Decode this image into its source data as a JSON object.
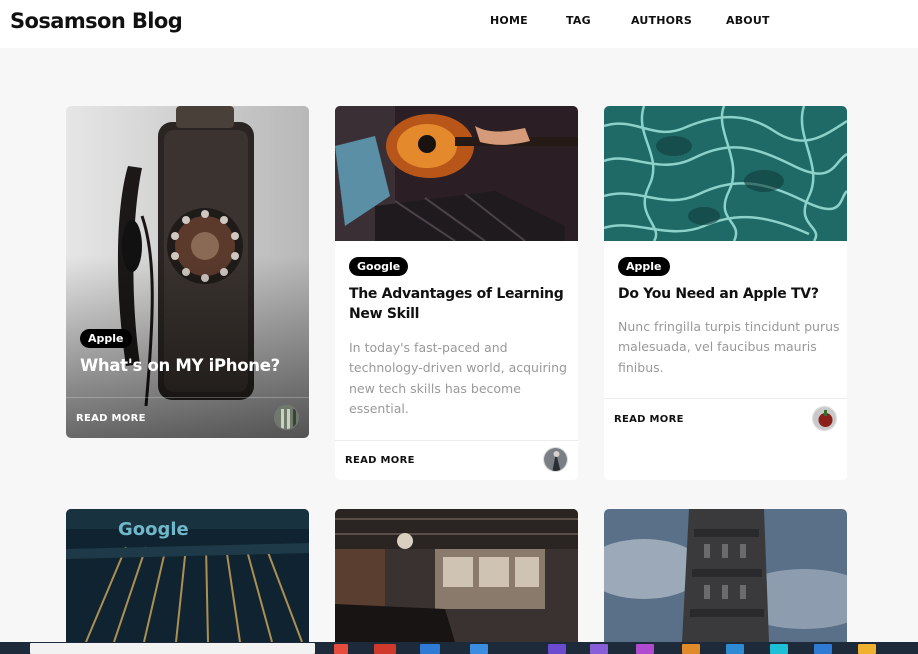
{
  "header": {
    "brand": "Sosamson Blog",
    "nav": [
      "HOME",
      "TAG",
      "AUTHORS",
      "ABOUT"
    ]
  },
  "cards": [
    {
      "category": "Apple",
      "title": "What's on MY iPhone?",
      "read_more": "READ MORE"
    },
    {
      "category": "Google",
      "title_line1": "The Advantages of Learning",
      "title_line2": "New Skill",
      "excerpt_lines": [
        "In today's fast-paced and",
        "technology-driven world, acquiring",
        "new tech skills has become",
        "essential."
      ],
      "read_more": "READ MORE"
    },
    {
      "category": "Apple",
      "title": "Do You Need an Apple TV?",
      "excerpt_lines": [
        "Nunc fringilla turpis tincidunt purus",
        "malesuada, vel faucibus mauris",
        "finibus."
      ],
      "read_more": "READ MORE"
    }
  ],
  "bottom_cards": [
    {
      "image": "google-building-photo",
      "image_text": "Google"
    },
    {
      "image": "loft-interior-photo"
    },
    {
      "image": "stone-tower-photo"
    }
  ]
}
